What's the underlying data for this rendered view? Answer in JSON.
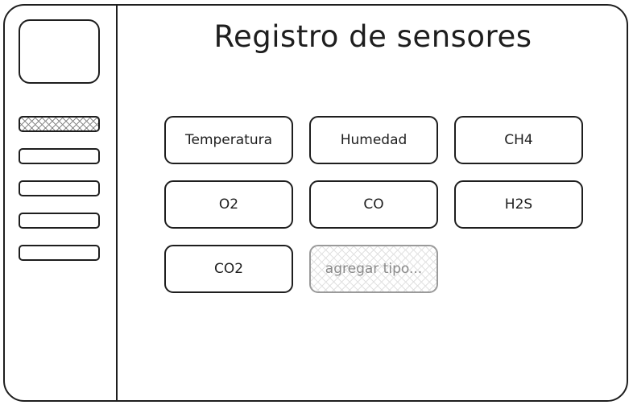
{
  "page": {
    "title": "Registro de sensores"
  },
  "sidebar": {
    "items": [
      {
        "id": "sidebar-item-1",
        "active": true
      },
      {
        "id": "sidebar-item-2",
        "active": false
      },
      {
        "id": "sidebar-item-3",
        "active": false
      },
      {
        "id": "sidebar-item-4",
        "active": false
      },
      {
        "id": "sidebar-item-5",
        "active": false
      }
    ]
  },
  "sensor_types": [
    {
      "label": "Temperatura"
    },
    {
      "label": "Humedad"
    },
    {
      "label": "CH4"
    },
    {
      "label": "O2"
    },
    {
      "label": "CO"
    },
    {
      "label": "H2S"
    },
    {
      "label": "CO2"
    }
  ],
  "add_type": {
    "placeholder": "agregar tipo..."
  },
  "colors": {
    "stroke": "#1e1e1e",
    "placeholder": "#8a8a8a",
    "hatch": "#8a8a8a"
  }
}
